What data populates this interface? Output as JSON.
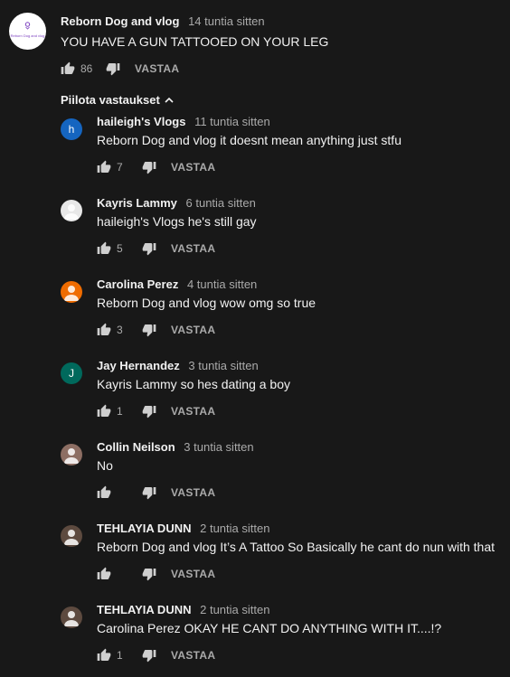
{
  "top_comment": {
    "author": "Reborn Dog and vlog",
    "time": "14 tuntia sitten",
    "text": "YOU HAVE A GUN TATTOOED ON YOUR LEG",
    "likes": "86",
    "reply_label": "VASTAA",
    "avatar_text": "Reborn Dog and vlog"
  },
  "hide_replies_label": "Piilota vastaukset",
  "replies": [
    {
      "author": "haileigh's Vlogs",
      "time": "11 tuntia sitten",
      "text": "Reborn Dog and vlog it doesnt mean anything just stfu",
      "likes": "7",
      "reply_label": "VASTAA",
      "avatar_letter": "h",
      "avatar_color": "#1565c0"
    },
    {
      "author": "Kayris Lammy",
      "time": "6 tuntia sitten",
      "text": "haileigh's Vlogs he's still gay",
      "likes": "5",
      "reply_label": "VASTAA",
      "avatar_letter": "",
      "avatar_color": "#e8e8e8"
    },
    {
      "author": "Carolina Perez",
      "time": "4 tuntia sitten",
      "text": "Reborn Dog and vlog wow omg so true",
      "likes": "3",
      "reply_label": "VASTAA",
      "avatar_letter": "",
      "avatar_color": "#ef6c00"
    },
    {
      "author": "Jay Hernandez",
      "time": "3 tuntia sitten",
      "text": "Kayris Lammy so hes dating a boy",
      "likes": "1",
      "reply_label": "VASTAA",
      "avatar_letter": "J",
      "avatar_color": "#00695c"
    },
    {
      "author": "Collin Neilson",
      "time": "3 tuntia sitten",
      "text": "No",
      "likes": "",
      "reply_label": "VASTAA",
      "avatar_letter": "",
      "avatar_color": "#8d6e63"
    },
    {
      "author": "TEHLAYIA DUNN",
      "time": "2 tuntia sitten",
      "text": "Reborn Dog and vlog It’s A Tattoo So Basically he cant do nun with that",
      "likes": "",
      "reply_label": "VASTAA",
      "avatar_letter": "",
      "avatar_color": "#5d4a3f"
    },
    {
      "author": "TEHLAYIA DUNN",
      "time": "2 tuntia sitten",
      "text": "Carolina Perez OKAY HE CANT DO ANYTHING WITH IT....!?",
      "likes": "1",
      "reply_label": "VASTAA",
      "avatar_letter": "",
      "avatar_color": "#5d4a3f"
    }
  ],
  "colors": {
    "background": "#181818",
    "text": "#f1f1f1",
    "secondary": "#aaaaaa"
  },
  "icons": {
    "like": "thumbs-up-icon",
    "dislike": "thumbs-down-icon",
    "chevron": "chevron-up-icon",
    "person": "person-icon"
  }
}
